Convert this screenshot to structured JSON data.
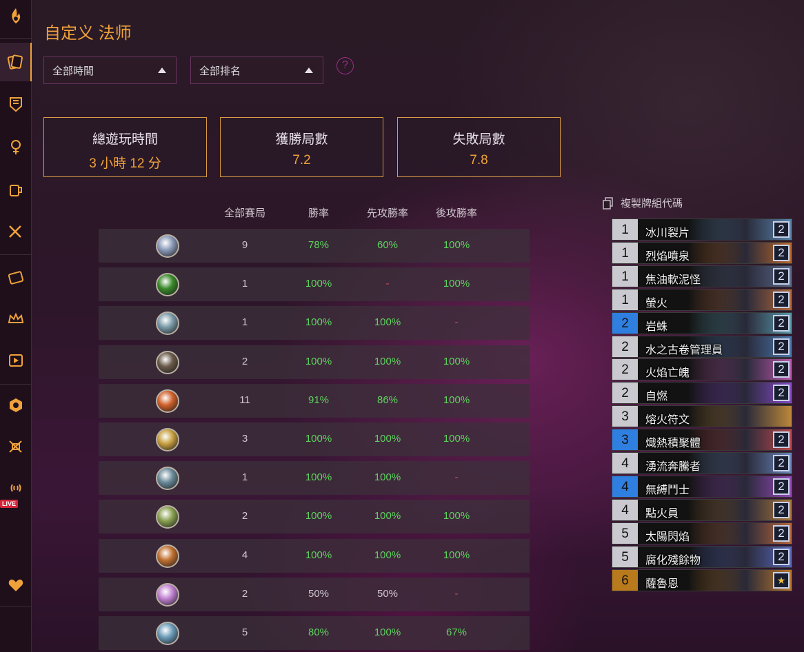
{
  "page": {
    "title": "自定义 法师"
  },
  "filters": {
    "time": "全部時間",
    "rank": "全部排名",
    "help": "?"
  },
  "stats": [
    {
      "label": "總遊玩時間",
      "value": "3 小時 12 分"
    },
    {
      "label": "獲勝局數",
      "value": "7.2"
    },
    {
      "label": "失敗局數",
      "value": "7.8"
    }
  ],
  "table": {
    "headers": [
      "全部賽局",
      "勝率",
      "先攻勝率",
      "後攻勝率"
    ],
    "rows": [
      {
        "hero": "mage-hero-icon",
        "games": "9",
        "winrate": "78%",
        "first": "60%",
        "second": "100%"
      },
      {
        "hero": "hunter-hero-icon",
        "games": "1",
        "winrate": "100%",
        "first": "-",
        "second": "100%"
      },
      {
        "hero": "druid-hero-icon",
        "games": "1",
        "winrate": "100%",
        "first": "100%",
        "second": "-"
      },
      {
        "hero": "rogue-hero-icon",
        "games": "2",
        "winrate": "100%",
        "first": "100%",
        "second": "100%"
      },
      {
        "hero": "warrior-hero-icon",
        "games": "11",
        "winrate": "91%",
        "first": "86%",
        "second": "100%"
      },
      {
        "hero": "paladin-hero-icon",
        "games": "3",
        "winrate": "100%",
        "first": "100%",
        "second": "100%"
      },
      {
        "hero": "shaman-hero-icon",
        "games": "1",
        "winrate": "100%",
        "first": "100%",
        "second": "-"
      },
      {
        "hero": "demon-hunter-hero-icon",
        "games": "2",
        "winrate": "100%",
        "first": "100%",
        "second": "100%"
      },
      {
        "hero": "warlock-hero-icon",
        "games": "4",
        "winrate": "100%",
        "first": "100%",
        "second": "100%"
      },
      {
        "hero": "priest-hero-icon",
        "games": "2",
        "winrate": "50%",
        "first": "50%",
        "second": "-"
      },
      {
        "hero": "death-knight-hero-icon",
        "games": "5",
        "winrate": "80%",
        "first": "100%",
        "second": "67%"
      }
    ]
  },
  "deck": {
    "copy_label": "複製牌組代碼",
    "cards": [
      {
        "cost": "1",
        "name": "冰川裂片",
        "count": "2",
        "cost_color": "gray",
        "art": "#5a87b0"
      },
      {
        "cost": "1",
        "name": "烈焰噴泉",
        "count": "2",
        "cost_color": "gray",
        "art": "#c06a2a"
      },
      {
        "cost": "1",
        "name": "焦油軟泥怪",
        "count": "2",
        "cost_color": "gray",
        "art": "#5a6a8a"
      },
      {
        "cost": "1",
        "name": "螢火",
        "count": "2",
        "cost_color": "gray",
        "art": "#b86a3a"
      },
      {
        "cost": "2",
        "name": "岩蛛",
        "count": "2",
        "cost_color": "blue",
        "art": "#5aa0b0"
      },
      {
        "cost": "2",
        "name": "水之古卷管理員",
        "count": "2",
        "cost_color": "gray",
        "art": "#4a7ab0"
      },
      {
        "cost": "2",
        "name": "火焰亡魄",
        "count": "2",
        "cost_color": "gray",
        "art": "#c05ab0"
      },
      {
        "cost": "2",
        "name": "自燃",
        "count": "2",
        "cost_color": "gray",
        "art": "#8a4ad0"
      },
      {
        "cost": "3",
        "name": "熔火符文",
        "count": "",
        "cost_color": "gray",
        "art": "#c08a3a"
      },
      {
        "cost": "3",
        "name": "熾熱積聚體",
        "count": "2",
        "cost_color": "blue",
        "art": "#c04a4a"
      },
      {
        "cost": "4",
        "name": "湧流奔騰者",
        "count": "2",
        "cost_color": "gray",
        "art": "#6a8ac0"
      },
      {
        "cost": "4",
        "name": "無縛鬥士",
        "count": "2",
        "cost_color": "blue",
        "art": "#9a4ac0"
      },
      {
        "cost": "4",
        "name": "點火員",
        "count": "2",
        "cost_color": "gray",
        "art": "#b07a3a"
      },
      {
        "cost": "5",
        "name": "太陽閃焰",
        "count": "2",
        "cost_color": "gray",
        "art": "#c06a3a"
      },
      {
        "cost": "5",
        "name": "腐化殘餘物",
        "count": "2",
        "cost_color": "gray",
        "art": "#5a6ac0"
      },
      {
        "cost": "6",
        "name": "薩魯恩",
        "count": "★",
        "cost_color": "gold",
        "art": "#c07a2a"
      }
    ]
  },
  "sidebar": {
    "live_badge": "LIVE"
  },
  "colors": {
    "accent": "#f0a23a",
    "positive": "#5ed35e",
    "dash": "#d24b57",
    "border": "#6a3562"
  }
}
